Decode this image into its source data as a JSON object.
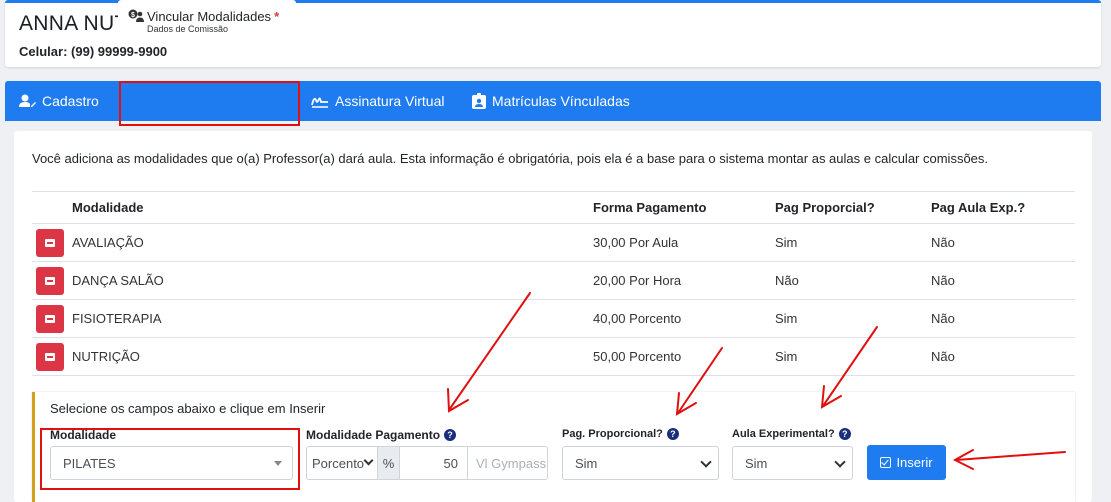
{
  "header": {
    "name": "ANNA NUTRI",
    "phone_label": "Celular:",
    "phone": "(99) 99999-9900"
  },
  "tabs": [
    {
      "label": "Cadastro",
      "icon": "user-edit-icon"
    },
    {
      "label": "Vincular Modalidades",
      "sub": "Dados de Comissão",
      "required": "*",
      "icon": "money-users-icon",
      "active": true
    },
    {
      "label": "Assinatura Virtual",
      "icon": "signature-icon"
    },
    {
      "label": "Matrículas Vínculadas",
      "icon": "id-badge-icon"
    }
  ],
  "intro": "Você adiciona as modalidades que o(a) Professor(a) dará aula. Esta informação é obrigatória, pois ela é a base para o sistema montar as aulas e calcular comissões.",
  "table": {
    "headers": [
      "Modalidade",
      "Forma Pagamento",
      "Pag Proporcial?",
      "Pag Aula Exp.?"
    ],
    "rows": [
      {
        "modalidade": "AVALIAÇÃO",
        "forma": "30,00 Por Aula",
        "prop": "Sim",
        "exp": "Não"
      },
      {
        "modalidade": "DANÇA SALÃO",
        "forma": "20,00 Por Hora",
        "prop": "Não",
        "exp": "Não"
      },
      {
        "modalidade": "FISIOTERAPIA",
        "forma": "40,00 Porcento",
        "prop": "Sim",
        "exp": "Não"
      },
      {
        "modalidade": "NUTRIÇÃO",
        "forma": "50,00 Porcento",
        "prop": "Sim",
        "exp": "Não"
      }
    ]
  },
  "form": {
    "title": "Selecione os campos abaixo e clique em Inserir",
    "modalidade_label": "Modalidade",
    "modalidade_value": "PILATES",
    "pagamento_label": "Modalidade Pagamento",
    "pagamento_tipo": "Porcento",
    "pagamento_symbol": "%",
    "pagamento_valor": "50",
    "pagamento_placeholder": "Vl Gympass",
    "proporcional_label": "Pag. Proporcional?",
    "proporcional_value": "Sim",
    "experimental_label": "Aula Experimental?",
    "experimental_value": "Sim",
    "help": "?",
    "insert_label": "Inserir"
  },
  "colors": {
    "primary": "#1e7cf0",
    "danger": "#dc3545",
    "annotation": "#e01010",
    "form_accent": "#d4a017"
  }
}
